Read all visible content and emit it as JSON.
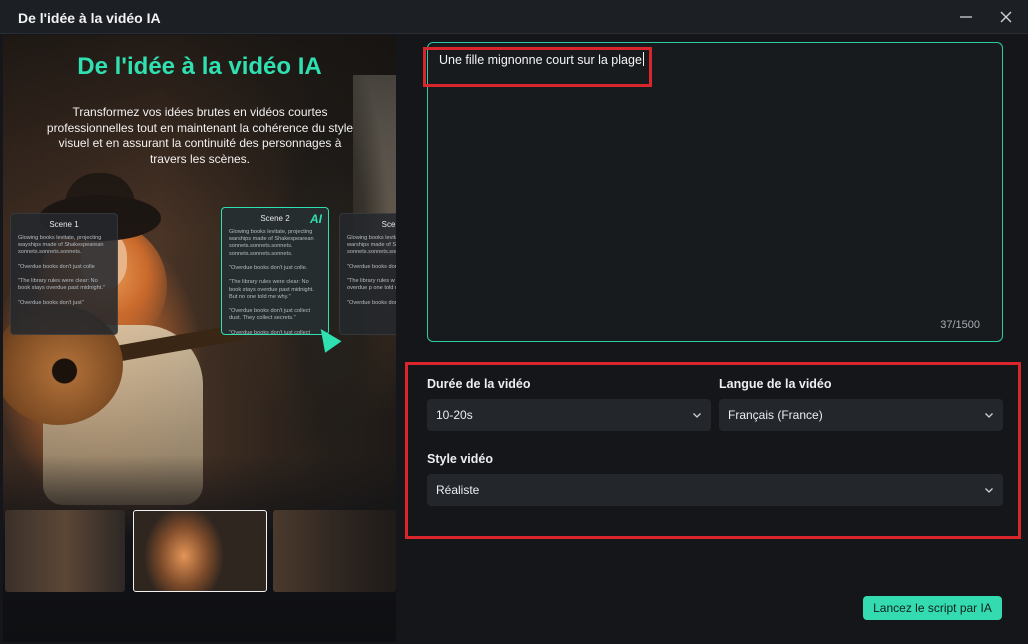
{
  "window": {
    "title": "De l'idée à la vidéo IA"
  },
  "promo": {
    "title": "De l'idée à la vidéo IA",
    "description": "Transformez vos idées brutes en vidéos courtes professionnelles tout en maintenant la cohérence du style visuel et en assurant la continuité des personnages à travers les scènes.",
    "ai_badge": "AI",
    "cards": [
      {
        "title": "Scene 1",
        "body": "Glowing books levitate, projecting wayships made of Shakespearean sonnets.sonnets.sonnets.\n\n\"Overdue books don't just colle\n\n\"The library rules were clear: No book stays overdue past midnight.\"\n\n\"Overdue books don't just\""
      },
      {
        "title": "Scene 2",
        "body": "Glowing books levitate, projecting warships made of Shakespearean sonnets.sonnets.sonnets. sonnets.sonnets.sonnets.\n\n\"Overdue books don't just colle.\n\n\"The library rules were clear: No book stays overdue past midnight. But no one told me why.\"\n\n\"Overdue books don't just collect dust. They collect secrets.\"\n\n\"Overdue books don't just collect dust.\""
      },
      {
        "title": "Scene",
        "body": "Glowing books levitate, projecting warships made of Shakespe sonnets.sonnets.sonnets.\n\n\"Overdue books don't\n\n\"The library rules w book stays overdue p one told me wh\n\n\"Overdue books don They collect s\""
      }
    ]
  },
  "prompt": {
    "value": "Une fille mignonne court sur la plage",
    "char_count": "37/1500"
  },
  "settings": {
    "duration_label": "Durée de la vidéo",
    "duration_value": "10-20s",
    "language_label": "Langue de la vidéo",
    "language_value": "Français (France)",
    "style_label": "Style vidéo",
    "style_value": "Réaliste"
  },
  "actions": {
    "generate_label": "Lancez le script par IA"
  },
  "colors": {
    "accent": "#2fe0b1",
    "highlight": "#d9262c",
    "background": "#141619"
  }
}
